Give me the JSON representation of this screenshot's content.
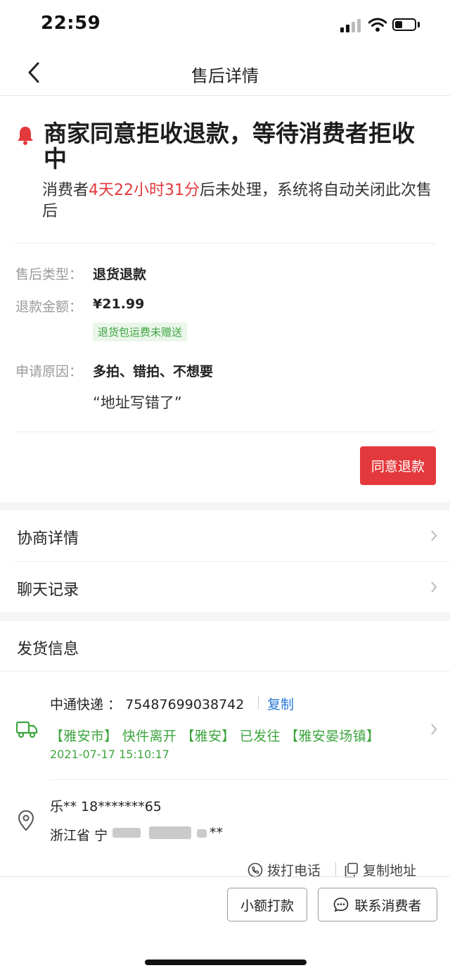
{
  "status_bar": {
    "time": "22:59"
  },
  "nav": {
    "title": "售后详情"
  },
  "status": {
    "headline": "商家同意拒收退款，等待消费者拒收中",
    "countdown_prefix": "消费者",
    "countdown_time": "4天22小时31分",
    "countdown_suffix": "后未处理，系统将自动关闭此次售后"
  },
  "details": {
    "type_label": "售后类型：",
    "type_value": "退货退款",
    "amount_label": "退款金额：",
    "amount_value": "¥21.99",
    "amount_tag": "退货包运费未赠送",
    "reason_label": "申请原因：",
    "reason_value": "多拍、错拍、不想要",
    "reason_note": "“地址写错了”"
  },
  "actions": {
    "agree_refund": "同意退款"
  },
  "menu": {
    "negotiation": "协商详情",
    "chat": "聊天记录"
  },
  "shipping": {
    "title": "发货信息",
    "carrier": "中通快递",
    "tracking_sep": "：",
    "tracking_no": "75487699038742",
    "copy": "复制",
    "track_status": "【雅安市】 快件离开 【雅安】 已发往 【雅安晏场镇】",
    "track_time": "2021-07-17 15:10:17",
    "receiver": "乐** 18*******65",
    "address_province": "浙江省",
    "address_start": "宁",
    "address_end": "**",
    "call": "拨打电话",
    "copy_address": "复制地址"
  },
  "bottom": {
    "small_payment": "小额打款",
    "contact": "联系消费者"
  },
  "colors": {
    "accent": "#e4393c",
    "green": "#3ea53f",
    "link": "#2a7ad6"
  }
}
